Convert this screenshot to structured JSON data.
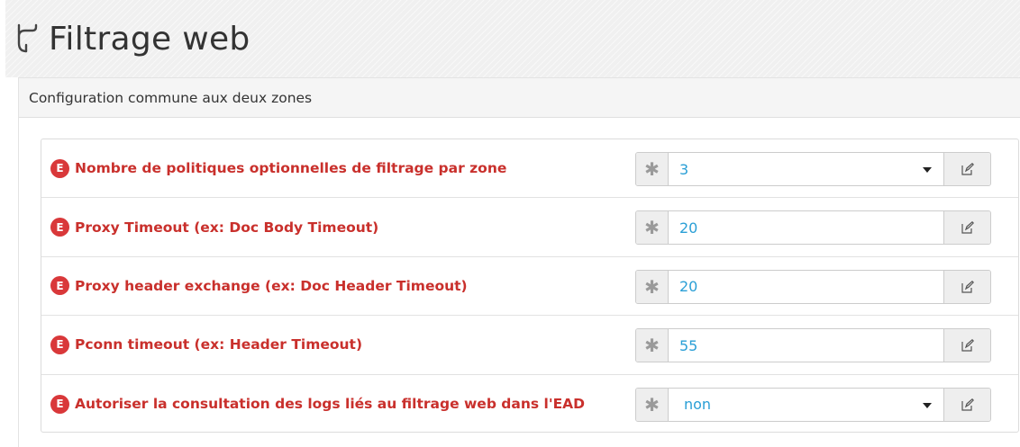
{
  "page": {
    "title": "Filtrage web",
    "title_icon": "fork-branch-icon"
  },
  "panel": {
    "heading": "Configuration commune aux deux zones"
  },
  "badge_letter": "E",
  "asterisk": "✱",
  "fields": [
    {
      "label": "Nombre de politiques optionnelles de filtrage par zone",
      "value": "3",
      "type": "select"
    },
    {
      "label": "Proxy Timeout (ex: Doc Body Timeout)",
      "value": "20",
      "type": "text"
    },
    {
      "label": "Proxy header exchange (ex: Doc Header Timeout)",
      "value": "20",
      "type": "text"
    },
    {
      "label": "Pconn timeout (ex: Header Timeout)",
      "value": "55",
      "type": "text"
    },
    {
      "label": "Autoriser la consultation des logs liés au filtrage web dans l'EAD",
      "value": "non",
      "type": "select"
    }
  ],
  "colors": {
    "label": "#c9302c",
    "badge": "#d9383a",
    "value": "#2a9fd6"
  }
}
